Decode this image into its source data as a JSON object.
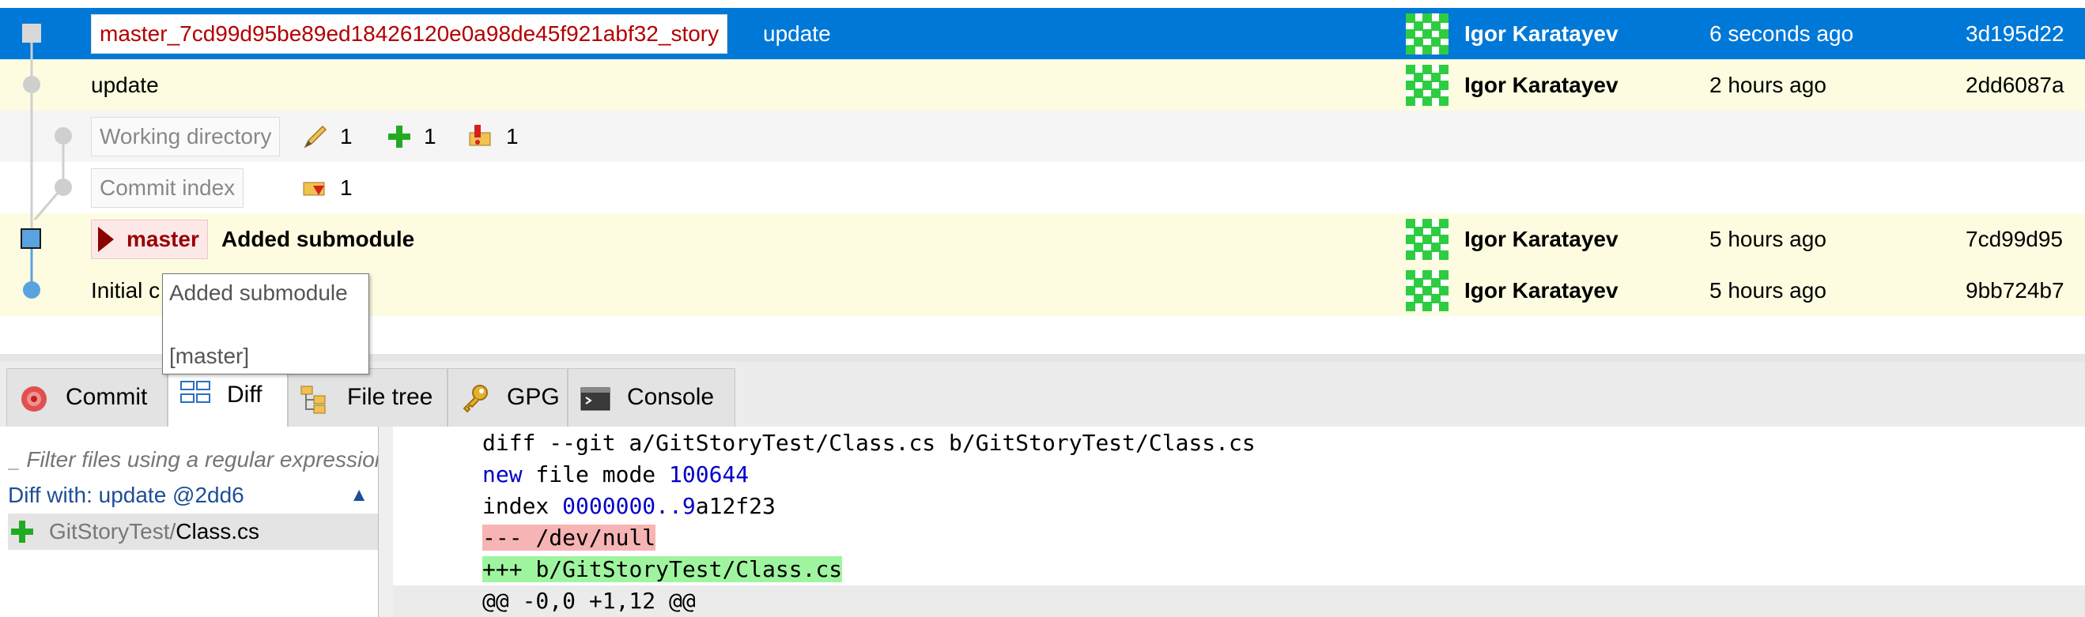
{
  "commits": [
    {
      "branch": "master_7cd99d95be89ed18426120e0a98de45f921abf32_story",
      "message": "update",
      "author": "Igor Karatayev",
      "date": "6 seconds ago",
      "hash": "3d195d22"
    },
    {
      "message": "update",
      "author": "Igor Karatayev",
      "date": "2 hours ago",
      "hash": "2dd6087a"
    },
    {
      "label": "Working directory",
      "stats": [
        "1",
        "1",
        "1"
      ]
    },
    {
      "label": "Commit index",
      "stats": [
        "1"
      ]
    },
    {
      "branch": "master",
      "message": "Added submodule",
      "author": "Igor Karatayev",
      "date": "5 hours ago",
      "hash": "7cd99d95"
    },
    {
      "message": "Initial c",
      "author": "Igor Karatayev",
      "date": "5 hours ago",
      "hash": "9bb724b7"
    }
  ],
  "tooltip": {
    "line1": "Added submodule",
    "line2": "[master]"
  },
  "tabs": [
    {
      "label": "Commit",
      "icon": "commit-icon"
    },
    {
      "label": "Diff",
      "icon": "diff-icon"
    },
    {
      "label": "File tree",
      "icon": "file-tree-icon"
    },
    {
      "label": "GPG",
      "icon": "key-icon"
    },
    {
      "label": "Console",
      "icon": "console-icon"
    }
  ],
  "filelist": {
    "filter_placeholder": "_ Filter files using a regular expression...",
    "diff_with": "Diff with: update @2dd6",
    "file_path": "GitStoryTest/",
    "file_name": "Class.cs"
  },
  "diff": {
    "line1": "diff --git a/GitStoryTest/Class.cs b/GitStoryTest/Class.cs",
    "line2_kw": "new",
    "line2_text": " file mode ",
    "line2_num": "100644",
    "line3_kw": "index",
    "line3_text": " ",
    "line3_num": "0000000..9",
    "line3_rest": "a12f23",
    "line4_prefix": "--- ",
    "line4_path": "/dev/null",
    "line5_prefix": "+++ ",
    "line5_path": "b/GitStoryTest/Class.cs",
    "line6": "@@ -0,0 +1,12 @@"
  },
  "colors": {
    "selection": "#0078d7",
    "row_highlight": "#fdfce0",
    "graph_line": "#c8c8c8",
    "branch_red": "#b30000"
  }
}
